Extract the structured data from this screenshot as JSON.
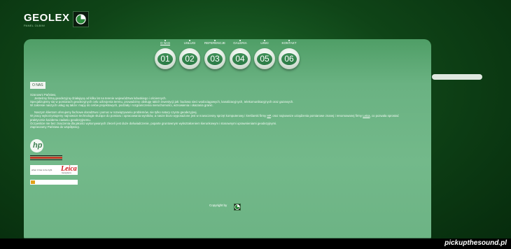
{
  "header": {
    "brand": "GEOLEX",
    "subtitle": "PANEL OLBIN!"
  },
  "nav": [
    {
      "label": "O NAS",
      "number": "01",
      "active": true
    },
    {
      "label": "USŁUGI",
      "number": "02"
    },
    {
      "label": "REFERENCJE",
      "number": "03"
    },
    {
      "label": "GALERIA",
      "number": "04"
    },
    {
      "label": "LINKI",
      "number": "05"
    },
    {
      "label": "KONTAKT",
      "number": "06"
    }
  ],
  "section": {
    "title": "O NAS"
  },
  "content": {
    "greeting": "Szanowni Państwo,",
    "p1": "Jesteśmy firmą geodezyjną działającą od kilku lat na terenie województwa lubuskiego i ościennych.",
    "p2": "Specjalizujemy się w pomiarach geodezyjnych celu uzbrojenia terenu, prowadzimy obsługę takich inwestycji jak: budowa sieci wodociągowych, kanalizacyjnych, telekomunikacyjnych oraz gazowych.",
    "p3": "W zakresie naszych usług są także: mapy do celów projektowych, podziały i rozgraniczenia nieruchomości, wznowienia i okazania granic.",
    "p4": "Naszym klientom oferujemy fachowe doradztwo i pomoc w rozwiązywaniu problemów, nie tylko natury czysto geodezyjnej.",
    "p5a": "W pracy wykorzystujemy najnowsze technologie służące do pomiaru i opracowania wyników, a nasze biuro wyposażone jest w nowoczesny sprzęt komputerowy i kreślarski firmy",
    "hp_link": "HP",
    "p5b": "oraz najnowsze urządzenia pomiarowe znanej i renomowanej firmy",
    "leica_link": "Leica",
    "p5c": ", co pozwala sprostać",
    "p6": "praktycznie każdemu zadaniu geodezyjnemu.",
    "p7": "Oczywiście nie bez znaczenia dla jakości wykonywanych zleceń jest duże doświadczenie, poparte gruntownym wykształceniem kierunkowym i stosownymi uprawnieniami geodezyjnymi.",
    "closing": "Zapraszamy Państwa do współpracy."
  },
  "logos": {
    "hp": "hp",
    "leica_tagline": "when it has to be right",
    "leica": "Leica",
    "leica_sub": "Geosystems"
  },
  "footer": {
    "copyright": "Copyright by"
  },
  "watermark": "pickupthesound.pl"
}
